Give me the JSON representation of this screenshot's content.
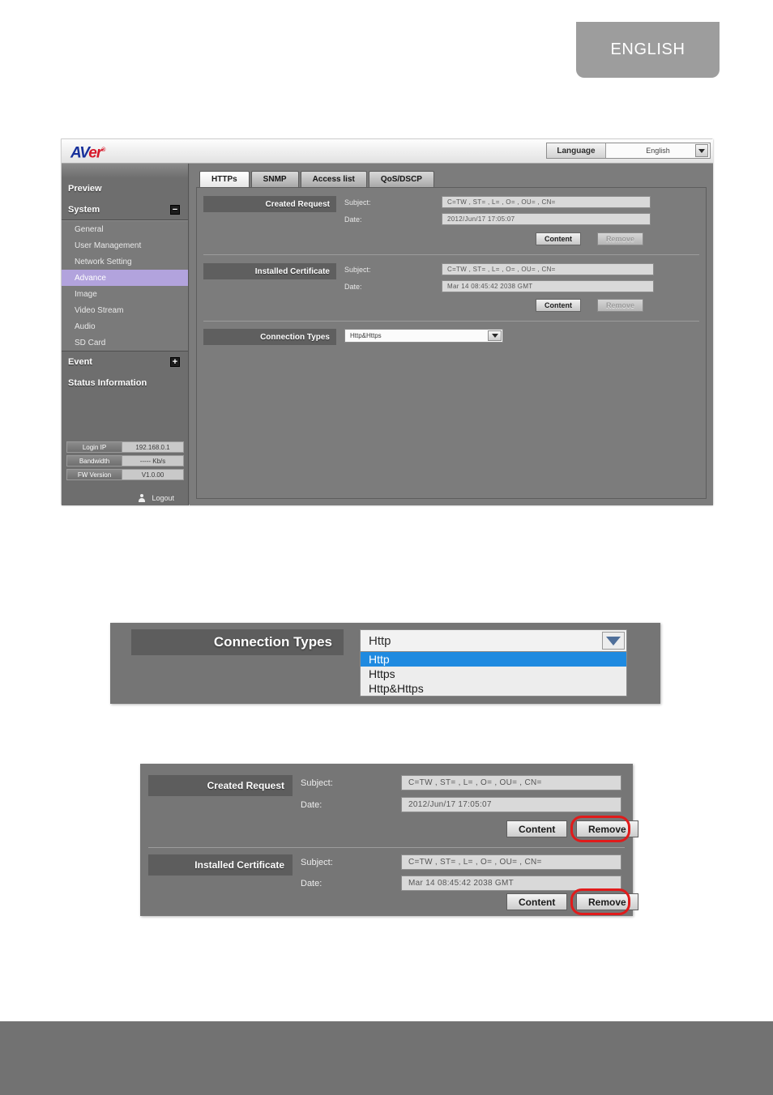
{
  "lang_tab": {
    "label": "ENGLISH"
  },
  "figure1": {
    "brand": {
      "av": "AV",
      "er": "er",
      "tm": "®"
    },
    "language_bar": {
      "label": "Language",
      "value": "English",
      "arrow_icon": "chevron-down-icon"
    },
    "sidebar": {
      "main_items": [
        {
          "label": "Preview",
          "toggle": ""
        },
        {
          "label": "System",
          "toggle": "−"
        }
      ],
      "sub_items": [
        {
          "label": "General",
          "active": false
        },
        {
          "label": "User Management",
          "active": false
        },
        {
          "label": "Network Setting",
          "active": false
        },
        {
          "label": "Advance",
          "active": true
        },
        {
          "label": "Image",
          "active": false
        },
        {
          "label": "Video Stream",
          "active": false
        },
        {
          "label": "Audio",
          "active": false
        },
        {
          "label": "SD Card",
          "active": false
        }
      ],
      "tail_items": [
        {
          "label": "Event",
          "toggle": "+"
        },
        {
          "label": "Status Information",
          "toggle": ""
        }
      ],
      "status": [
        {
          "key": "Login IP",
          "value": "192.168.0.1"
        },
        {
          "key": "Bandwidth",
          "value": "----- Kb/s"
        },
        {
          "key": "FW Version",
          "value": "V1.0.00"
        }
      ],
      "logout": {
        "label": "Logout",
        "icon": "user-icon"
      }
    },
    "tabs": [
      {
        "label": "HTTPs",
        "active": true
      },
      {
        "label": "SNMP",
        "active": false
      },
      {
        "label": "Access list",
        "active": false
      },
      {
        "label": "QoS/DSCP",
        "active": false
      }
    ],
    "created_request": {
      "title": "Created Request",
      "subject_label": "Subject:",
      "subject_value": "C=TW , ST= , L= , O= , OU= , CN=",
      "date_label": "Date:",
      "date_value": "2012/Jun/17 17:05:07",
      "content_button": "Content",
      "remove_button": "Remove"
    },
    "installed_certificate": {
      "title": "Installed Certificate",
      "subject_label": "Subject:",
      "subject_value": "C=TW , ST= , L= , O= , OU= , CN=",
      "date_label": "Date:",
      "date_value": "Mar 14 08:45:42 2038 GMT",
      "content_button": "Content",
      "remove_button": "Remove"
    },
    "connection_types": {
      "title": "Connection Types",
      "value": "Http&Https",
      "arrow_icon": "chevron-down-icon"
    }
  },
  "figure2": {
    "title": "Connection Types",
    "selected_value": "Http",
    "arrow_icon": "chevron-down-icon",
    "options": [
      {
        "label": "Http",
        "selected": true
      },
      {
        "label": "Https",
        "selected": false
      },
      {
        "label": "Http&Https",
        "selected": false
      }
    ]
  },
  "figure3": {
    "created_request": {
      "title": "Created Request",
      "subject_label": "Subject:",
      "subject_value": "C=TW , ST= , L= , O= , OU= , CN=",
      "date_label": "Date:",
      "date_value": "2012/Jun/17 17:05:07",
      "content_button": "Content",
      "remove_button": "Remove"
    },
    "installed_certificate": {
      "title": "Installed Certificate",
      "subject_label": "Subject:",
      "subject_value": "C=TW , ST= , L= , O= , OU= , CN=",
      "date_label": "Date:",
      "date_value": "Mar 14 08:45:42 2038 GMT",
      "content_button": "Content",
      "remove_button": "Remove"
    },
    "highlight_color": "#e01b1b"
  }
}
